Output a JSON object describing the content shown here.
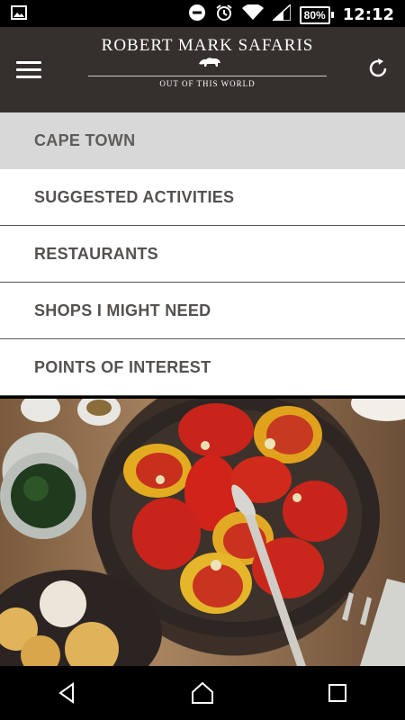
{
  "status": {
    "time": "12:12",
    "battery": "80%"
  },
  "header": {
    "brand_name": "ROBERT MARK SAFARIS",
    "tagline": "OUT OF THIS WORLD"
  },
  "menu": {
    "title": "CAPE TOWN",
    "items": [
      {
        "label": "SUGGESTED ACTIVITIES"
      },
      {
        "label": "RESTAURANTS"
      },
      {
        "label": "SHOPS I MIGHT NEED"
      },
      {
        "label": "POINTS OF INTEREST"
      }
    ]
  },
  "icons": {
    "menu": "hamburger-icon",
    "refresh": "refresh-icon",
    "back": "back-icon",
    "home": "home-icon",
    "recents": "recents-icon"
  },
  "colors": {
    "header_bg": "#35302d",
    "menu_title_bg": "#d8d8d8",
    "menu_text": "#55514f"
  }
}
